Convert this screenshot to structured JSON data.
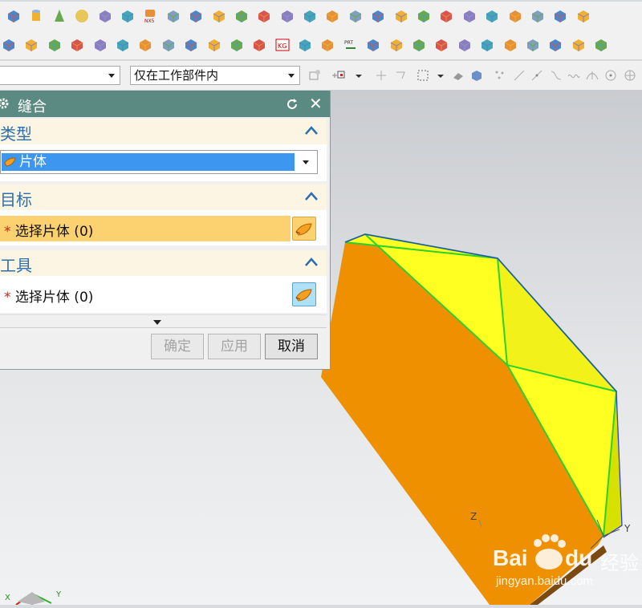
{
  "toolbar": {
    "row1_icons": [
      "block-icon",
      "cylinder-icon",
      "cone-icon",
      "sphere-icon",
      "extrude-icon",
      "revolve-icon",
      "nx5-tube-icon",
      "hole-icon",
      "boss-icon",
      "pocket-icon",
      "pad-icon",
      "slot-icon",
      "cylinder-pocket-icon",
      "emboss-icon",
      "thread-icon",
      "offset-face-icon",
      "pattern-icon",
      "array-icon",
      "rib-icon",
      "combine-icon",
      "boolean-icon",
      "sheet-metal-icon",
      "face-icon",
      "box-icon",
      "box2-icon",
      "overflow-icon"
    ],
    "row2_icons": [
      "cube-red-icon",
      "envelope-icon",
      "draft-icon",
      "mesh-icon",
      "surface-icon",
      "xy-plane-icon",
      "circle-dashed-icon",
      "wire-cube-icon",
      "color-bars-icon",
      "ring-icon",
      "shaded-face-icon",
      "ruler-icon",
      "kg-icon",
      "analysis-icon",
      "link-icon",
      "prt-icon",
      "tree-icon",
      "layers-icon",
      "trim-icon",
      "axes-icon",
      "cluster-icon",
      "tube-icon",
      "yellow-face-icon",
      "green-blade-icon",
      "green-bar-icon",
      "green-rect-icon",
      "overflow-icon"
    ],
    "nx5_label": "NX5",
    "prt_label": "PRT",
    "kg_label": "KG"
  },
  "selection_bar": {
    "filter_value": "",
    "scope_value": "仅在工作部件内"
  },
  "dialog": {
    "title": "缝合",
    "type_section": {
      "title": "类型",
      "selected": "片体"
    },
    "target_section": {
      "title": "目标",
      "select_label": "选择片体 (0)",
      "required_mark": "*"
    },
    "tool_section": {
      "title": "工具",
      "select_label": "选择片体 (0)",
      "required_mark": "*"
    },
    "buttons": {
      "ok": "确定",
      "apply": "应用",
      "cancel": "取消"
    }
  },
  "viewport": {
    "axis_labels": {
      "z": "Z",
      "y": "Y",
      "x": "X"
    },
    "colors": {
      "side_face": "#ef9000",
      "top_face": "#ffff22",
      "edge": "#2bd12b",
      "outline": "#3040d0"
    }
  },
  "watermark": {
    "brand": "Bai",
    "brand2": "du",
    "cn": "经验",
    "url": "jingyan.baidu.com"
  }
}
